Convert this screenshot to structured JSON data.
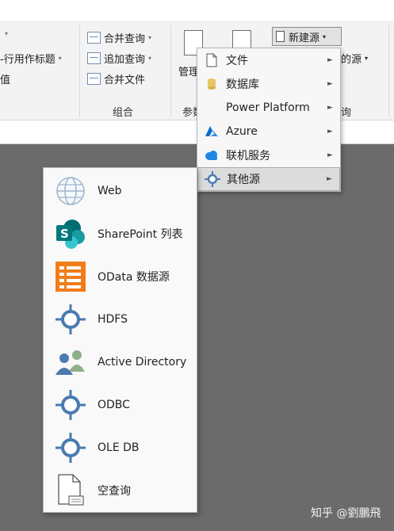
{
  "ribbon": {
    "combine_group": {
      "label": "组合",
      "items": [
        "合并查询",
        "追加查询",
        "合并文件"
      ]
    },
    "left_group": {
      "items": [
        "-行用作标题",
        "值"
      ]
    },
    "params_group": {
      "button_label_partial": "管理参数",
      "group_label_partial": "参数"
    },
    "new_source_button": "新建源",
    "recent_sources_partial": "的源",
    "query_group_label_partial": "询"
  },
  "new_source_menu": {
    "items": [
      {
        "label": "文件",
        "icon": "file-icon"
      },
      {
        "label": "数据库",
        "icon": "database-icon"
      },
      {
        "label": "Power Platform",
        "icon": "power-platform-icon"
      },
      {
        "label": "Azure",
        "icon": "azure-icon"
      },
      {
        "label": "联机服务",
        "icon": "cloud-icon"
      },
      {
        "label": "其他源",
        "icon": "other-source-icon"
      }
    ],
    "active_index": 5
  },
  "other_sources_menu": {
    "items": [
      {
        "label": "Web",
        "icon": "globe-icon"
      },
      {
        "label": "SharePoint 列表",
        "icon": "sharepoint-icon"
      },
      {
        "label": "OData 数据源",
        "icon": "odata-icon"
      },
      {
        "label": "HDFS",
        "icon": "hdfs-icon"
      },
      {
        "label": "Active Directory",
        "icon": "active-directory-icon"
      },
      {
        "label": "ODBC",
        "icon": "odbc-icon"
      },
      {
        "label": "OLE DB",
        "icon": "oledb-icon"
      },
      {
        "label": "空查询",
        "icon": "blank-query-icon"
      }
    ]
  },
  "watermark": "知乎 @劉鵬飛",
  "colors": {
    "background": "#6b6b6b",
    "ribbon": "#f3f3f3",
    "menu_active": "#dcdcdc",
    "connector_blue": "#4a7ab0",
    "odata_orange": "#f07d1a",
    "sharepoint_teal": "#038387",
    "azure_blue": "#0a6ed1",
    "cloud_blue": "#1e88e5"
  }
}
